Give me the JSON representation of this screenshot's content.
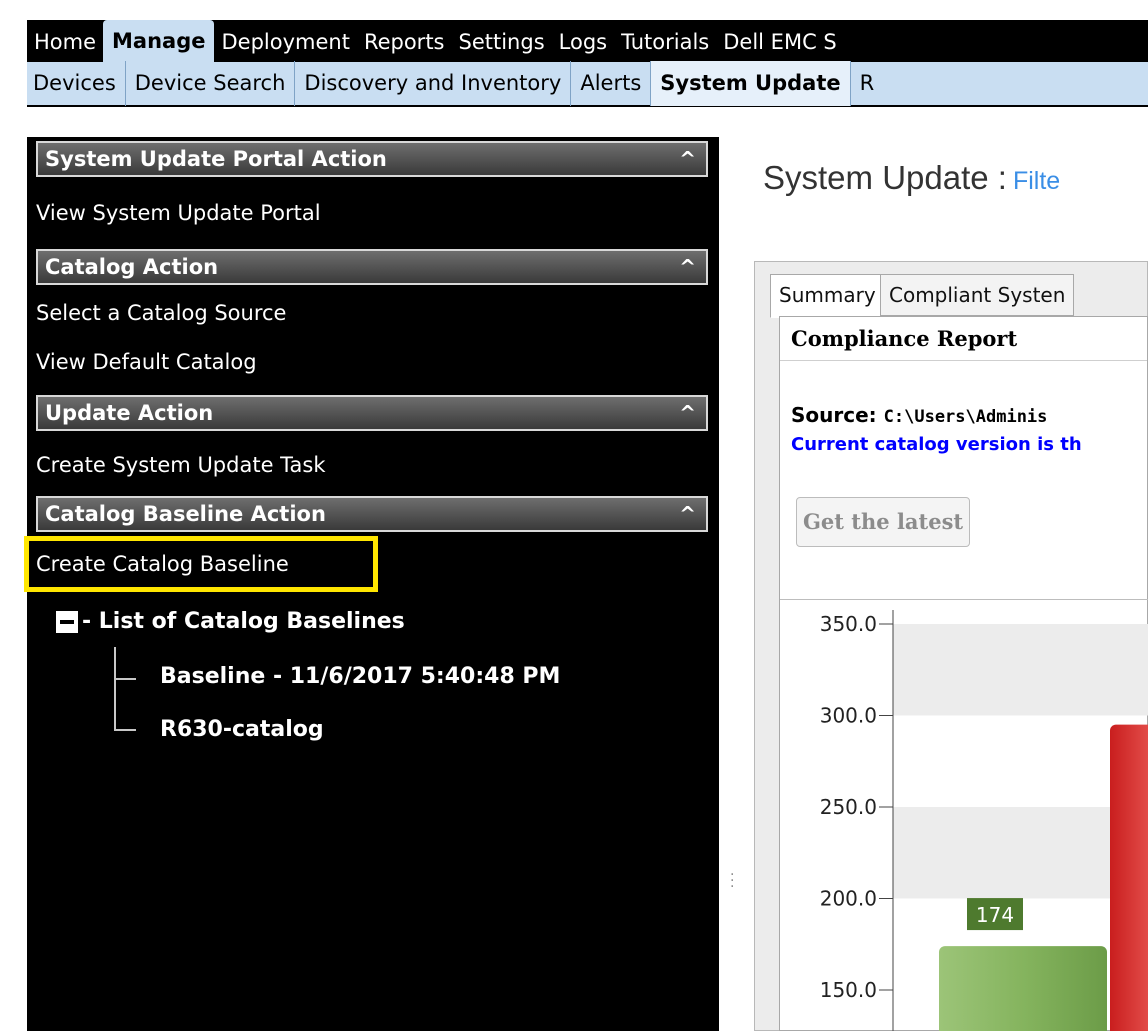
{
  "topnav": {
    "tabs": [
      "Home",
      "Manage",
      "Deployment",
      "Reports",
      "Settings",
      "Logs",
      "Tutorials",
      "Dell EMC S"
    ],
    "active": "Manage"
  },
  "subnav": {
    "tabs": [
      "Devices",
      "Device Search",
      "Discovery and Inventory",
      "Alerts",
      "System Update",
      "R"
    ],
    "active": "System Update"
  },
  "sidebar": {
    "sections": [
      {
        "header": "System Update Portal Action",
        "caret": "^",
        "items": [
          "View System Update Portal"
        ]
      },
      {
        "header": "Catalog Action",
        "caret": "^",
        "items": [
          "Select a Catalog Source",
          "View Default Catalog"
        ]
      },
      {
        "header": "Update Action",
        "caret": "^",
        "items": [
          "Create System Update Task"
        ]
      },
      {
        "header": "Catalog Baseline Action",
        "caret": "^",
        "items": [
          "Create Catalog Baseline"
        ]
      }
    ],
    "tree": {
      "root": "- List of Catalog Baselines",
      "children": [
        "Baseline - 11/6/2017 5:40:48 PM",
        "R630-catalog"
      ]
    }
  },
  "main": {
    "title": "System Update :",
    "filter_link": "Filte",
    "tabs": [
      "Summary",
      "Compliant Systen"
    ],
    "report": {
      "header": "Compliance Report",
      "source_label": "Source:",
      "source_path": "C:\\Users\\Adminis",
      "catalog_version": "Current catalog version is th",
      "get_latest_button": "Get the latest"
    }
  },
  "chart_data": {
    "type": "bar",
    "categories": [
      "",
      ""
    ],
    "series": [
      {
        "name": "",
        "values": [
          174,
          295
        ]
      }
    ],
    "colors": [
      "#7aa84f",
      "#d9322a"
    ],
    "data_labels": [
      "174",
      ""
    ],
    "ytick_labels": [
      "150.0",
      "200.0",
      "250.0",
      "300.0",
      "350.0"
    ],
    "ylim": [
      140,
      350
    ],
    "grid": true
  }
}
